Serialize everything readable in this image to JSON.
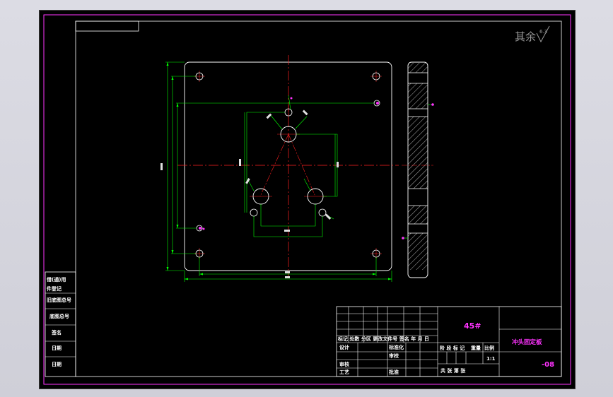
{
  "colors": {
    "background": "#000000",
    "frame": "#ff33ff",
    "border": "#ffffff",
    "outline": "#ffffff",
    "dimension": "#00ff00",
    "centerline": "#ff2020",
    "hatch": "#ffffff"
  },
  "surface_note": {
    "text": "其余",
    "value": "6.3"
  },
  "left_strip": {
    "rows": [
      "借(通)用",
      "件登记",
      "旧底图总号",
      "底图总号",
      "签名",
      "日期",
      "日期"
    ]
  },
  "title_block": {
    "material": "45#",
    "part_name": "冲头固定板",
    "drawing_number": "-08",
    "scale": "1:1",
    "revision_header": "标记 处数 分区 更改文件号 签名 年 月 日",
    "label_design": "设计",
    "label_standard": "标准化",
    "label_check": "审核",
    "label_process": "工艺",
    "label_approve": "批准",
    "label_review": "审校",
    "label_stage": "阶 段 标 记",
    "label_weight": "重量",
    "label_scale": "比例",
    "sheets": "共   张   第   张"
  }
}
